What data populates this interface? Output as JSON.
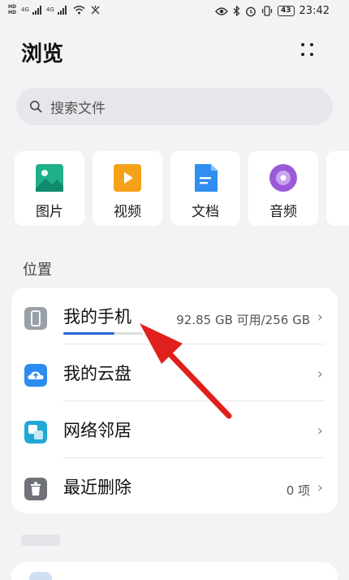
{
  "status_bar": {
    "hd_top": "HD",
    "hd_bottom": "HD",
    "net1": "4G",
    "net2": "4G",
    "battery": "43",
    "time": "23:42",
    "icons": [
      "eye-icon",
      "bluetooth-icon",
      "alarm-icon",
      "vibrate-icon",
      "wifi-icon"
    ]
  },
  "header": {
    "title": "浏览"
  },
  "search": {
    "placeholder": "搜索文件"
  },
  "categories": [
    {
      "label": "图片",
      "icon": "image-icon",
      "color": "#1fb08a"
    },
    {
      "label": "视频",
      "icon": "video-icon",
      "color": "#f5a21a"
    },
    {
      "label": "文档",
      "icon": "document-icon",
      "color": "#2f8ef0"
    },
    {
      "label": "音频",
      "icon": "audio-icon",
      "color": "#9a5ad8"
    }
  ],
  "location": {
    "label": "位置",
    "items": [
      {
        "label": "我的手机",
        "value": "92.85 GB 可用/256 GB",
        "icon": "phone-icon",
        "storage_used_fraction": 0.64
      },
      {
        "label": "我的云盘",
        "value": "",
        "icon": "cloud-icon"
      },
      {
        "label": "网络邻居",
        "value": "",
        "icon": "network-icon"
      },
      {
        "label": "最近删除",
        "value": "0 项",
        "icon": "trash-icon"
      }
    ]
  },
  "colors": {
    "accent": "#2a67d6",
    "arrow": "#e0201c",
    "background": "#f1f3f5"
  }
}
